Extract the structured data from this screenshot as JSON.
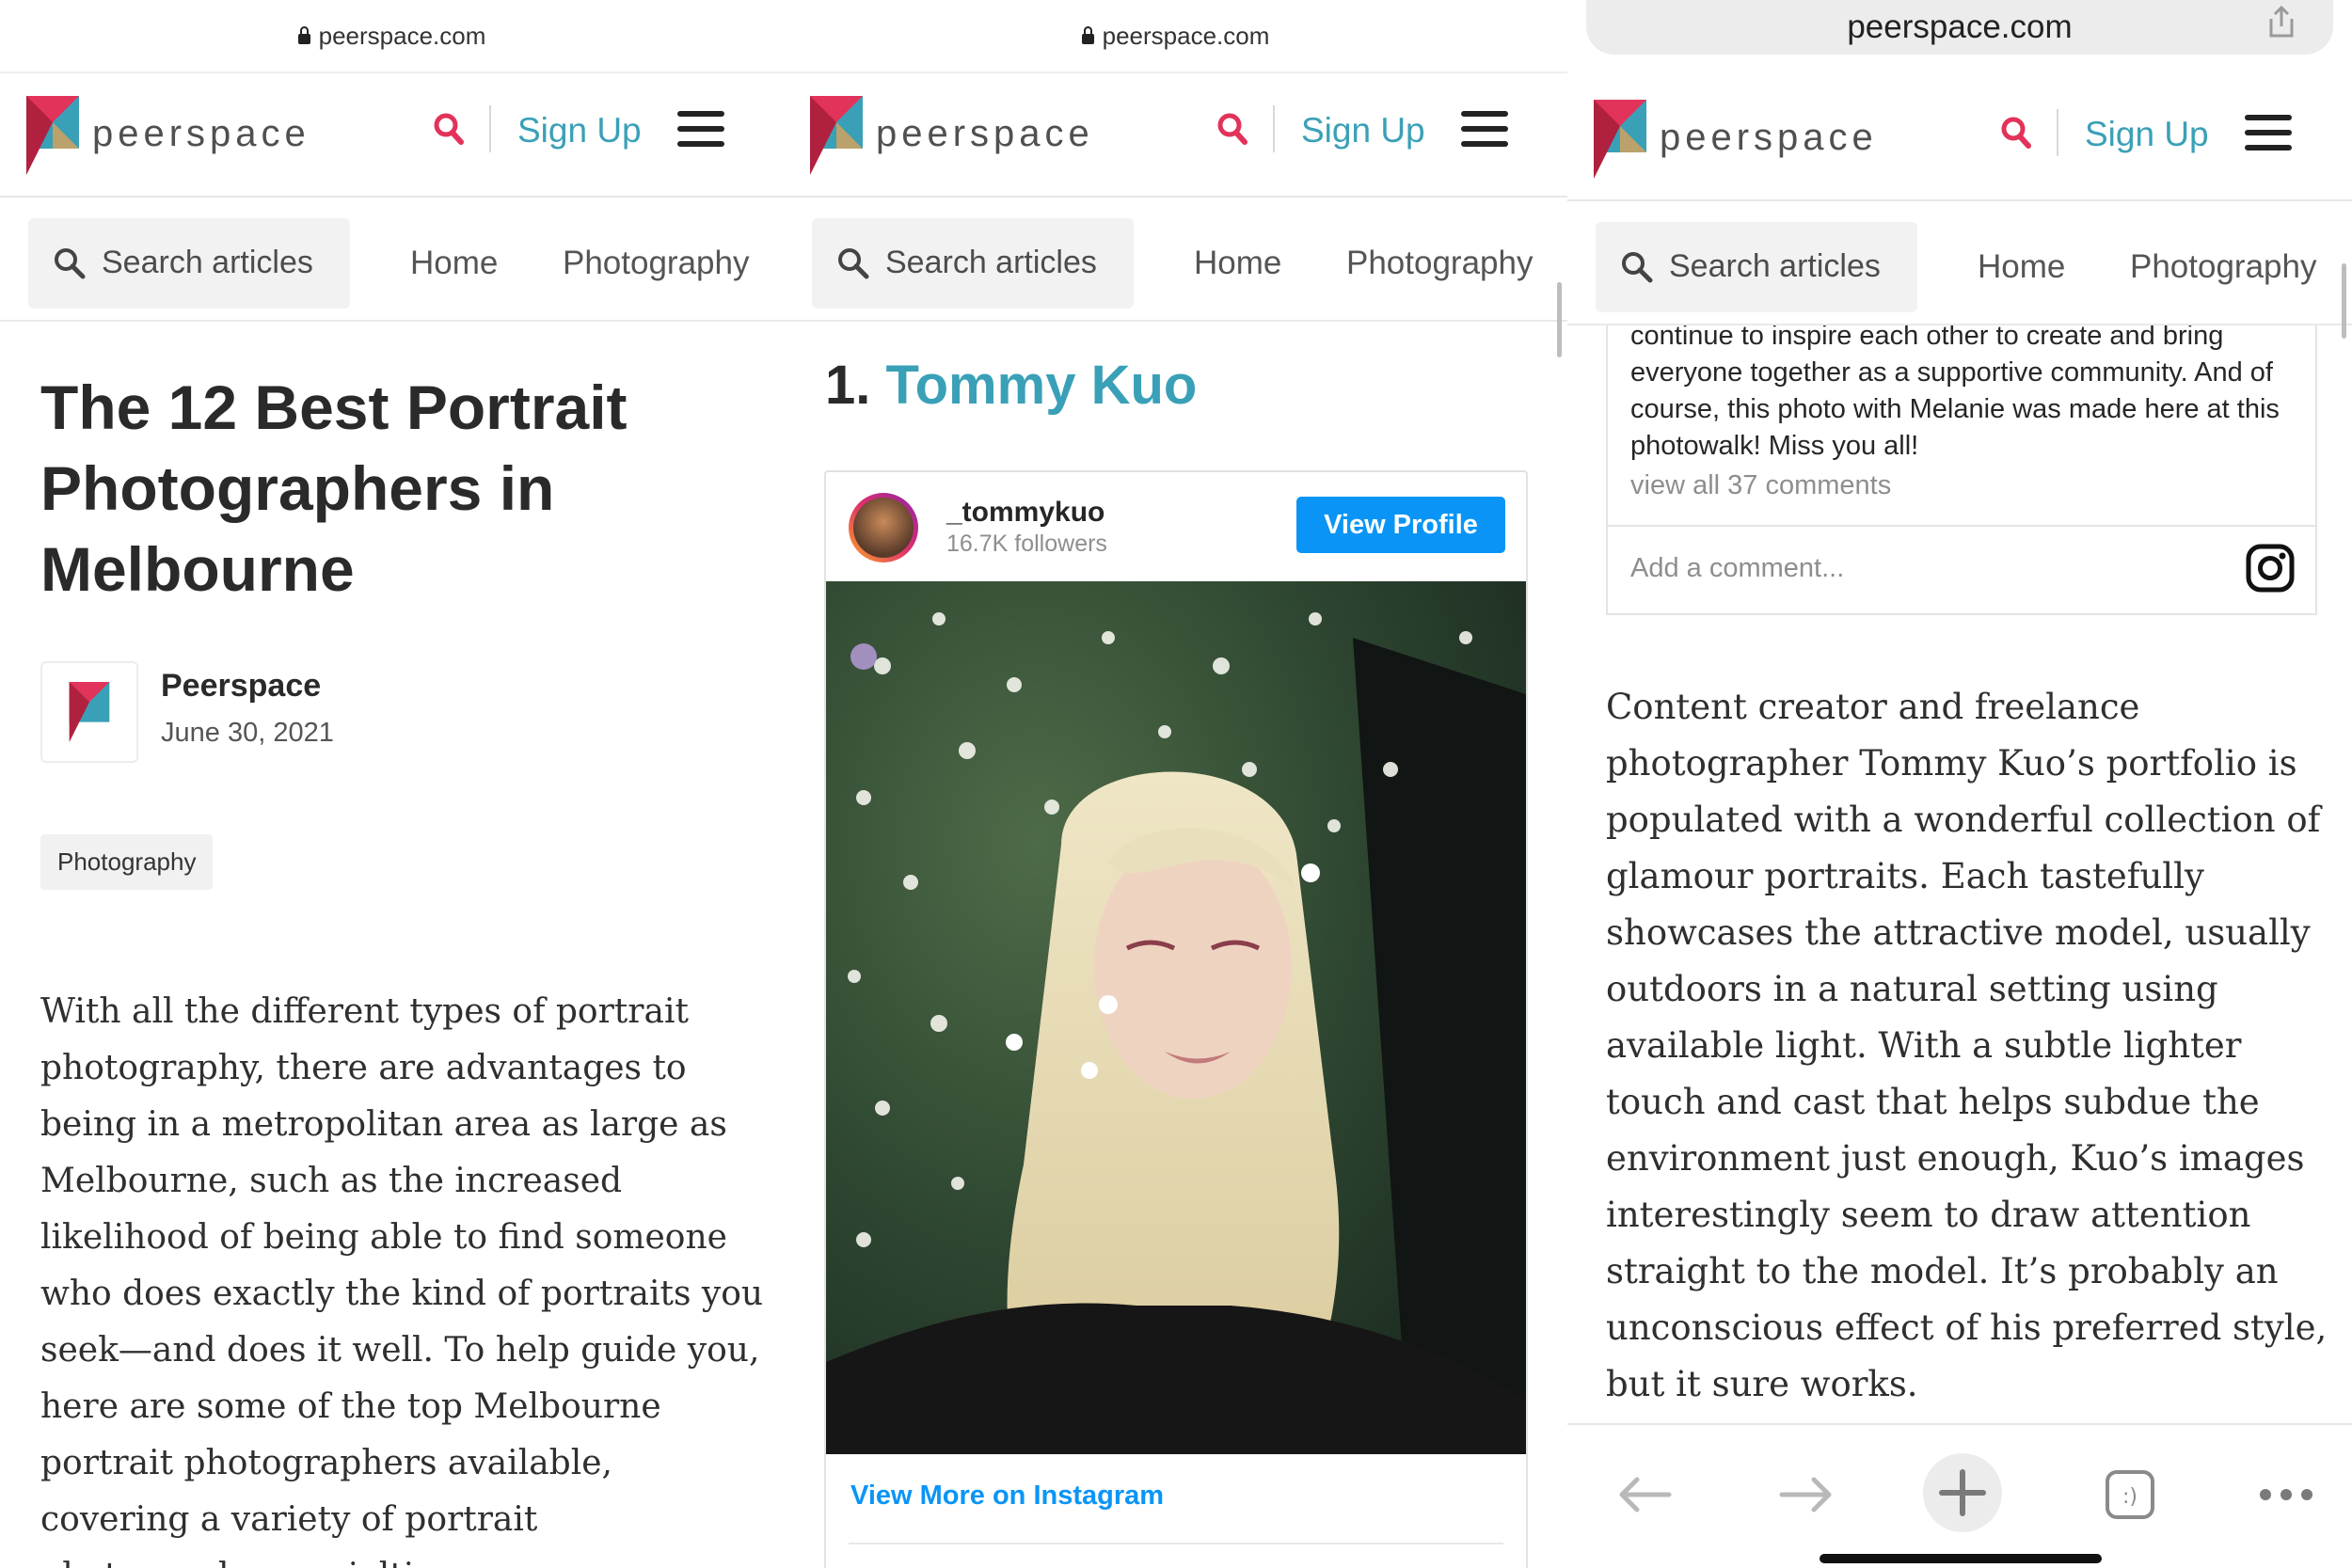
{
  "browser": {
    "url": "peerspace.com"
  },
  "site": {
    "brand": "peerspace",
    "signup_label": "Sign Up",
    "search_placeholder": "Search articles",
    "nav": [
      "Home",
      "Photography"
    ]
  },
  "colors": {
    "accent_teal": "#3aa0b7",
    "brand_red": "#e2335a",
    "instagram_blue": "#0a95f6"
  },
  "panel1": {
    "title": "The 12 Best Portrait Photographers in Melbourne",
    "author": "Peerspace",
    "date": "June 30, 2021",
    "tag": "Photography",
    "intro": "With all the different types of portrait photography, there are advantages to being in a metropolitan area as large as Melbourne, such as the increased likelihood of being able to find someone who does exactly the kind of portraits you seek—and does it well. To help guide you, here are some of the top Melbourne portrait photographers available, covering a variety of portrait photography specialties."
  },
  "panel2": {
    "heading_number": "1.",
    "heading_name": "Tommy Kuo",
    "instagram": {
      "handle": "_tommykuo",
      "followers": "16.7K followers",
      "view_profile": "View Profile",
      "view_more": "View More on Instagram"
    }
  },
  "panel3": {
    "comment_text": "continue to inspire each other to create and bring everyone together as a supportive community. And of course, this photo with Melanie was made here at this photowalk! Miss you all!",
    "view_all_comments": "view all 37 comments",
    "add_comment_placeholder": "Add a comment...",
    "body": "Content creator and freelance photographer Tommy Kuo’s portfolio is populated with a wonderful collection of glamour portraits. Each tastefully showcases the attractive model, usually outdoors in a natural setting using available light. With a subtle lighter touch and cast that helps subdue the environment just enough, Kuo’s images interestingly seem to draw attention straight to the model. It’s probably an unconscious effect of his preferred style, but it sure works."
  },
  "icons": [
    "lock-icon",
    "peerspace-logo",
    "search-icon",
    "menu-icon",
    "instagram-icon",
    "share-icon",
    "back-arrow-icon",
    "forward-arrow-icon",
    "new-tab-plus-icon",
    "tabs-icon",
    "more-dots-icon"
  ]
}
